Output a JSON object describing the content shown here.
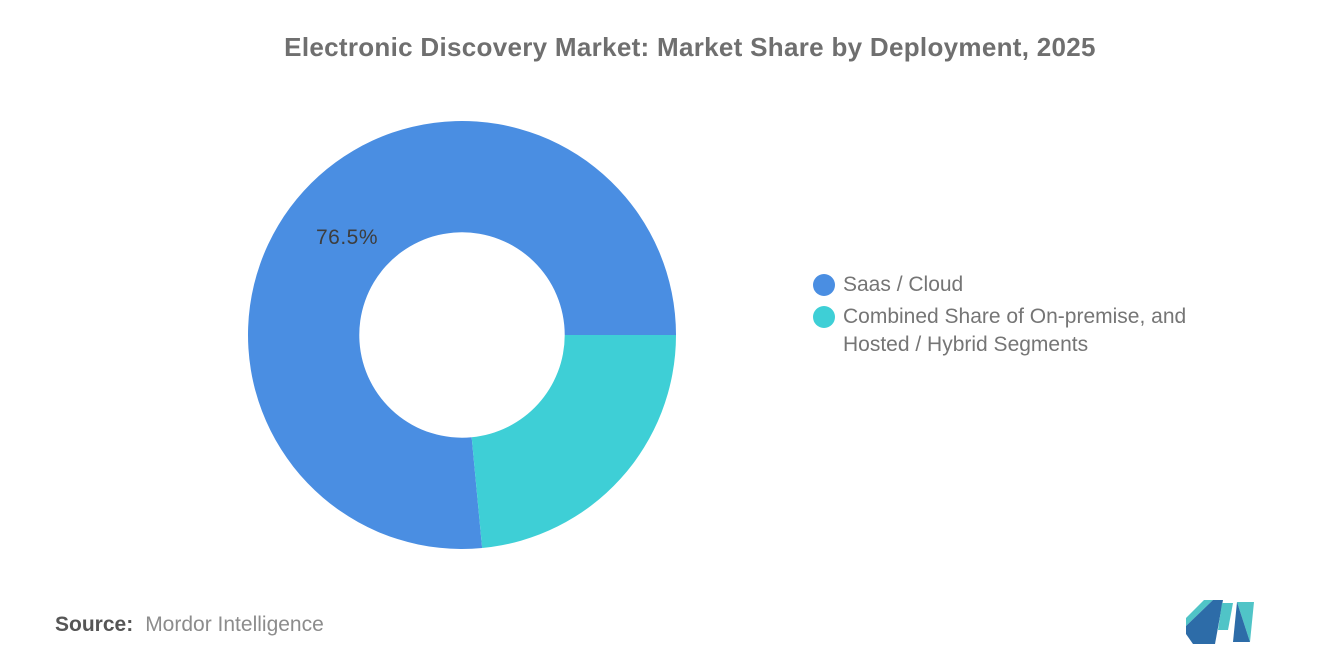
{
  "title": "Electronic Discovery Market: Market Share by Deployment, 2025",
  "chart_data": {
    "type": "pie",
    "subtype": "donut",
    "title": "Electronic Discovery Market: Market Share by Deployment, 2025",
    "slices": [
      {
        "label": "Saas / Cloud",
        "value": 76.5,
        "color": "#4A8EE2",
        "data_label": "76.5%"
      },
      {
        "label": "Combined Share of On-premise, and Hosted / Hybrid Segments",
        "value": 23.5,
        "color": "#3ECFD6",
        "data_label": ""
      }
    ],
    "units": "percent",
    "total": 100,
    "rotation_deg_clockwise_from_east": 84.6,
    "inner_radius_ratio": 0.48,
    "legend_position": "right",
    "grid": false
  },
  "pie_label": "76.5%",
  "legend": {
    "items": [
      {
        "label": "Saas / Cloud",
        "color": "#4A8EE2"
      },
      {
        "label": "Combined Share of On-premise, and\nHosted / Hybrid Segments",
        "color": "#3ECFD6"
      }
    ]
  },
  "source": {
    "label": "Source:",
    "value": "Mordor Intelligence"
  },
  "logo": {
    "name": "mordor-intelligence-logo",
    "teal": "#50C4C7",
    "blue": "#2D6CA8"
  }
}
